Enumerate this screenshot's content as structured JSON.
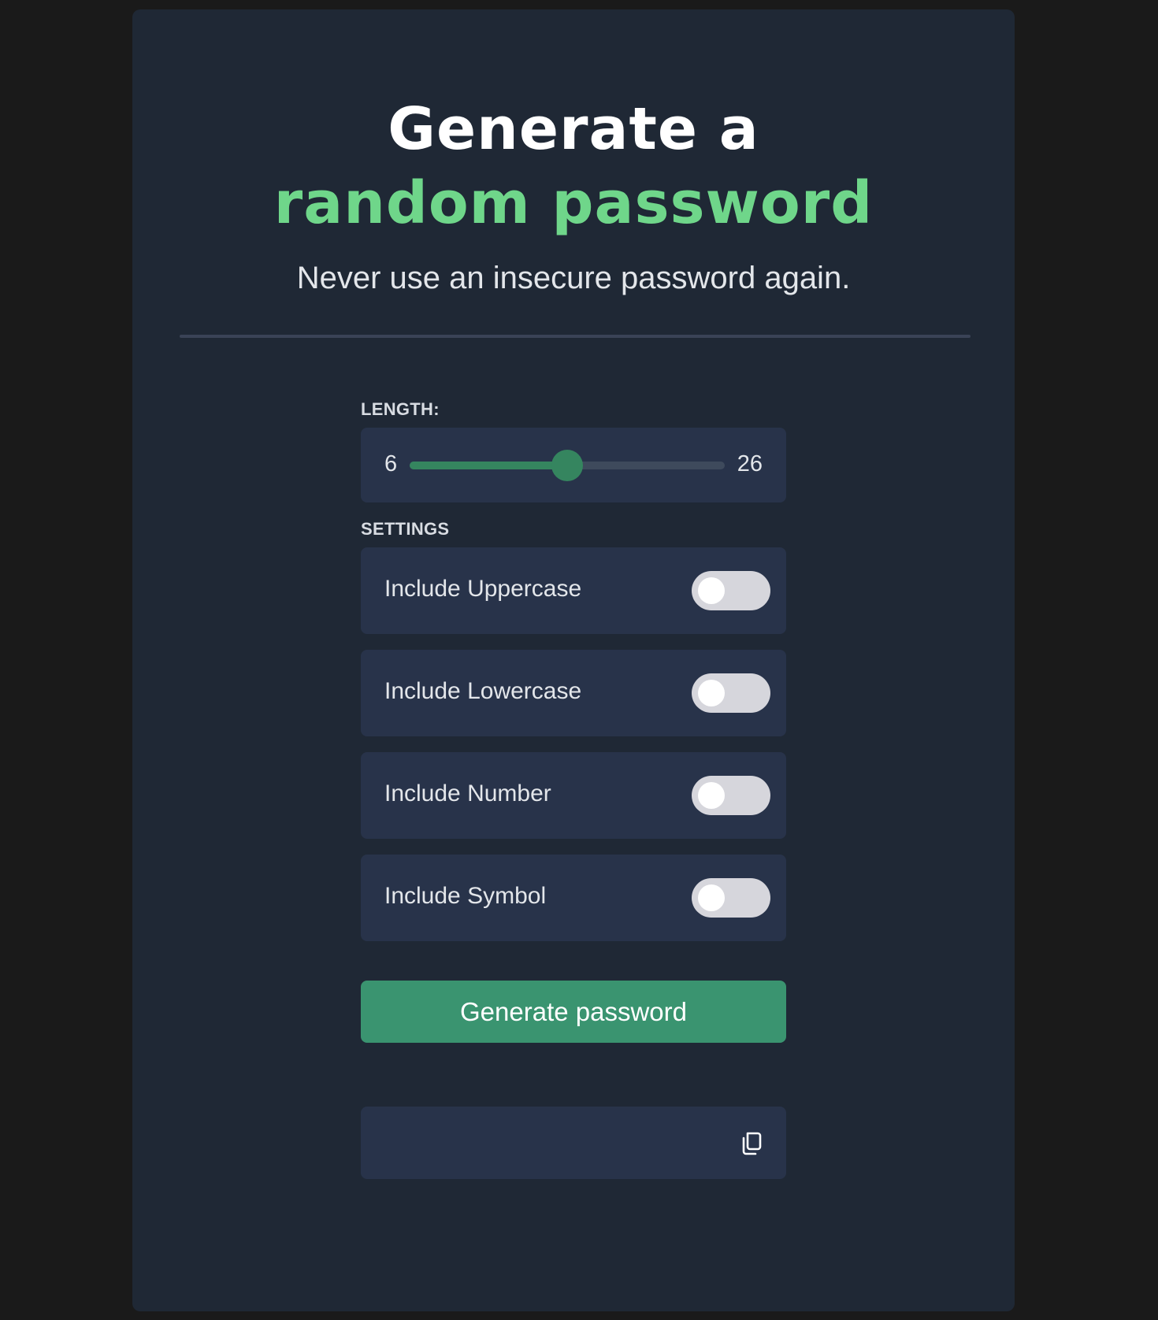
{
  "header": {
    "title_line1": "Generate a",
    "title_line2": "random password",
    "subtitle": "Never use an insecure password again."
  },
  "length": {
    "label": "LENGTH:",
    "min_label": "6",
    "max_label": "26",
    "value_fraction": 0.5
  },
  "settings": {
    "label": "SETTINGS",
    "items": [
      {
        "label": "Include Uppercase",
        "enabled": false
      },
      {
        "label": "Include Lowercase",
        "enabled": false
      },
      {
        "label": "Include Number",
        "enabled": false
      },
      {
        "label": "Include Symbol",
        "enabled": false
      }
    ]
  },
  "actions": {
    "generate_label": "Generate password"
  },
  "output": {
    "password": "",
    "copy_icon": "copy-icon"
  },
  "colors": {
    "accent": "#6fd68a",
    "button": "#3a9470",
    "card": "#1f2835",
    "panel": "#28334a",
    "page": "#1a1a1a"
  }
}
